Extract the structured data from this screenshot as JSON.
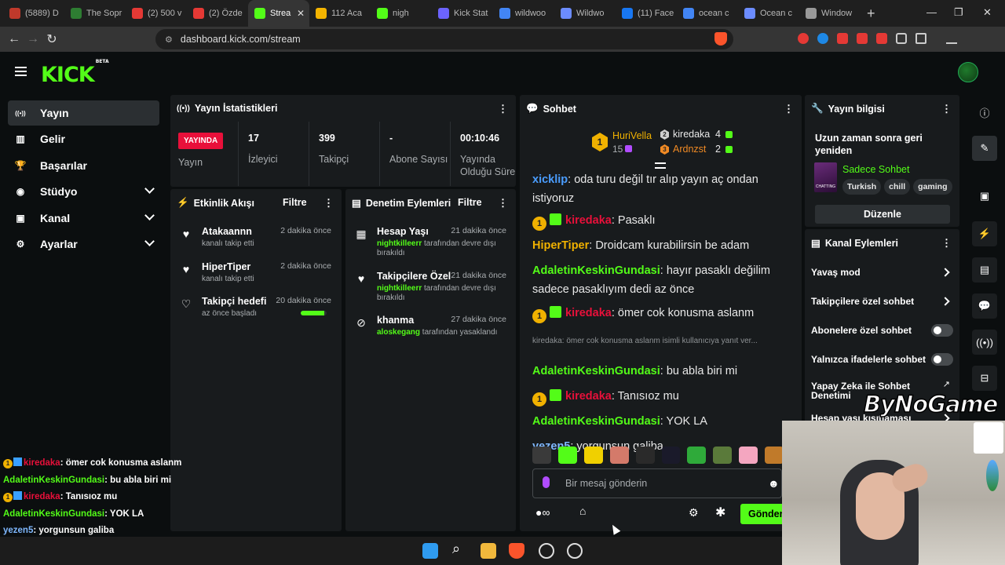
{
  "browser": {
    "tabs": [
      {
        "label": "(5889) D",
        "fav_color": "#c0392b"
      },
      {
        "label": "The Sopr",
        "fav_color": "#2e7d32"
      },
      {
        "label": "(2) 500 v",
        "fav_color": "#e53935"
      },
      {
        "label": "(2) Özde",
        "fav_color": "#e53935"
      },
      {
        "label": "Strea",
        "fav_color": "#53fc18",
        "active": true
      },
      {
        "label": "112 Aca",
        "fav_color": "#f4b400"
      },
      {
        "label": "nigh",
        "fav_color": "#53fc18"
      },
      {
        "label": "Kick Stat",
        "fav_color": "#6c63ff"
      },
      {
        "label": "wildwoo",
        "fav_color": "#4285f4"
      },
      {
        "label": "Wildwo",
        "fav_color": "#6c8cff"
      },
      {
        "label": "(11) Face",
        "fav_color": "#1877f2"
      },
      {
        "label": "ocean c",
        "fav_color": "#4285f4"
      },
      {
        "label": "Ocean c",
        "fav_color": "#6c8cff"
      },
      {
        "label": "Window",
        "fav_color": "#999999"
      }
    ],
    "url": "dashboard.kick.com/stream"
  },
  "brand": {
    "logo": "KICK",
    "beta": "BETA",
    "accent": "#53fc18"
  },
  "sidebar": {
    "items": [
      {
        "label": "Yayın",
        "icon": "broadcast-icon",
        "active": true
      },
      {
        "label": "Gelir",
        "icon": "revenue-icon"
      },
      {
        "label": "Başarılar",
        "icon": "trophy-icon"
      },
      {
        "label": "Stüdyo",
        "icon": "studio-icon",
        "expandable": true
      },
      {
        "label": "Kanal",
        "icon": "channel-icon",
        "expandable": true
      },
      {
        "label": "Ayarlar",
        "icon": "gear-icon",
        "expandable": true
      }
    ]
  },
  "stats": {
    "title": "Yayın İstatistikleri",
    "live_badge": "YAYINDA",
    "live_label": "Yayın",
    "items": [
      {
        "value": "17",
        "label": "İzleyici"
      },
      {
        "value": "399",
        "label": "Takipçi"
      },
      {
        "value": "-",
        "label": "Abone Sayısı"
      },
      {
        "value": "00:10:46",
        "label": "Yayında Olduğu Süre"
      }
    ]
  },
  "activity": {
    "title": "Etkinlik Akışı",
    "filter": "Filtre",
    "events": [
      {
        "name": "Atakaannn",
        "sub": "kanalı takip etti",
        "time": "2 dakika önce",
        "icon": "heart-icon"
      },
      {
        "name": "HiperTiper",
        "sub": "kanalı takip etti",
        "time": "2 dakika önce",
        "icon": "heart-icon"
      },
      {
        "name": "Takipçi hedefi",
        "sub": "az önce başladı",
        "time": "20 dakika önce",
        "icon": "heart-outline-icon",
        "progress": 0.9
      }
    ]
  },
  "moderation": {
    "title": "Denetim Eylemleri",
    "filter": "Filtre",
    "events": [
      {
        "name": "Hesap Yaşı",
        "actor": "nightkilleerr",
        "sub": " tarafından devre dışı bırakıldı",
        "time": "21 dakika önce",
        "icon": "calendar-icon"
      },
      {
        "name": "Takipçilere Özel",
        "actor": "nightkilleerr",
        "sub": " tarafından devre dışı bırakıldı",
        "time": "21 dakika önce",
        "icon": "heart-icon"
      },
      {
        "name": "khanma",
        "actor": "aloskegang",
        "sub": " tarafından yasaklandı",
        "time": "27 dakika önce",
        "icon": "ban-icon"
      }
    ]
  },
  "chat": {
    "title": "Sohbet",
    "top": [
      {
        "rank": "1",
        "name": "HuriVella",
        "count": "15",
        "color": "#f0b100"
      },
      {
        "rank": "2",
        "name": "kiredaka",
        "count": "4",
        "color": "#cfcfcf"
      },
      {
        "rank": "3",
        "name": "Ardnzst",
        "count": "2",
        "color": "#f08a24"
      }
    ],
    "messages": [
      {
        "user": "xicklip",
        "color": "#4a9dff",
        "text": ": oda turu değil tır alıp yayın aç ondan istiyoruz"
      },
      {
        "user": "kiredaka",
        "color": "#e8103a",
        "text": ": Pasaklı",
        "badges": true
      },
      {
        "user": "HiperTiper",
        "color": "#f0b100",
        "text": ": Droidcam kurabilirsin be adam"
      },
      {
        "user": "AdaletinKeskinGundasi",
        "color": "#53fc18",
        "text": ": hayır pasaklı değilim sadece pasaklıyım dedi az önce"
      },
      {
        "user": "kiredaka",
        "color": "#e8103a",
        "text": ": ömer cok konusma aslanm",
        "badges": true
      },
      {
        "user": "AdaletinKeskinGundasi",
        "color": "#53fc18",
        "text": ": bu abla biri mi"
      },
      {
        "user": "kiredaka",
        "color": "#e8103a",
        "text": ": Tanısıoz mu",
        "badges": true
      },
      {
        "user": "AdaletinKeskinGundasi",
        "color": "#53fc18",
        "text": ": YOK LA"
      },
      {
        "user": "yezen5",
        "color": "#7fb8ff",
        "text": ": yorgunsun galiba"
      }
    ],
    "reply_preview": "kiredaka: ömer cok konusma aslanm isimli kullanıcıya yanıt ver...",
    "input_placeholder": "Bir mesaj gönderin",
    "send_label": "Gönder"
  },
  "stream_info": {
    "title": "Yayın bilgisi",
    "stream_title": "Uzun zaman sonra geri yeniden",
    "category": "Sadece Sohbet",
    "thumb_label": "CHATTING",
    "tags": [
      "Turkish",
      "chill",
      "gaming"
    ],
    "edit_label": "Düzenle"
  },
  "channel_actions": {
    "title": "Kanal Eylemleri",
    "items": [
      {
        "label": "Yavaş mod",
        "kind": "arrow"
      },
      {
        "label": "Takipçilere özel sohbet",
        "kind": "arrow"
      },
      {
        "label": "Abonelere özel sohbet",
        "kind": "toggle"
      },
      {
        "label": "Yalnızca ifadelerle sohbet",
        "kind": "toggle"
      },
      {
        "label": "Yapay Zeka ile Sohbet Denetimi",
        "kind": "external"
      },
      {
        "label": "Hesap yaşı kısıtlaması",
        "kind": "arrow"
      }
    ]
  },
  "overlay": {
    "messages": [
      {
        "user": "kiredaka",
        "color": "#e8103a",
        "text": ": ömer cok konusma aslanm",
        "badges": true
      },
      {
        "user": "AdaletinKeskinGundasi",
        "color": "#53fc18",
        "text": ": bu abla biri mi"
      },
      {
        "user": "kiredaka",
        "color": "#e8103a",
        "text": ": Tanısıoz mu",
        "badges": true
      },
      {
        "user": "AdaletinKeskinGundasi",
        "color": "#53fc18",
        "text": ": YOK LA"
      },
      {
        "user": "yezen5",
        "color": "#7fb8ff",
        "text": ": yorgunsun galiba"
      }
    ],
    "watermark": "ByNoGame"
  }
}
